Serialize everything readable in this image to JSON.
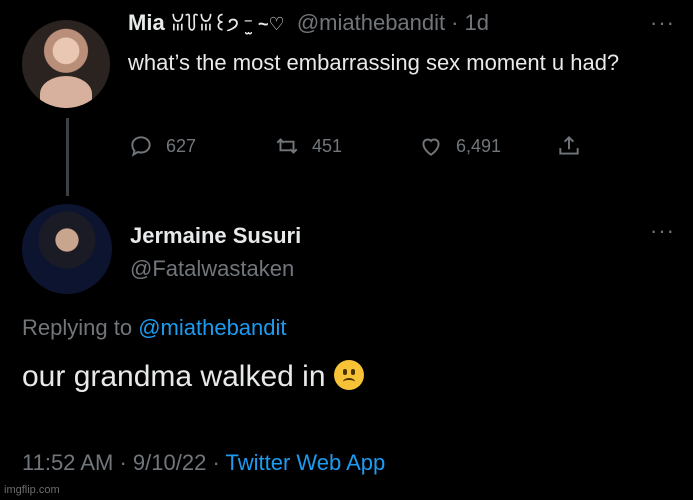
{
  "tweet": {
    "name": "Mia",
    "name_decoration": "ꈍ꒦ꈍ꒰੭ ⁻̫ ~♡",
    "handle": "@miathebandit",
    "separator": "·",
    "age": "1d",
    "text": "what’s the most embarrassing sex moment u had?",
    "more": "···",
    "stats": {
      "replies": "627",
      "retweets": "451",
      "likes": "6,491"
    }
  },
  "reply": {
    "name": "Jermaine Susuri",
    "handle": "@Fatalwastaken",
    "replying_prefix": "Replying to",
    "replying_to": "@miathebandit",
    "text": "our grandma walked in",
    "emoji": "slightly-frowning-face",
    "more": "···"
  },
  "meta": {
    "time": "11:52 AM",
    "date": "9/10/22",
    "sep": "·",
    "source": "Twitter Web App"
  },
  "watermark": "imgflip.com",
  "colors": {
    "background": "#000000",
    "text": "#e7e9ea",
    "muted": "#71767b",
    "link": "#1d9bf0"
  }
}
